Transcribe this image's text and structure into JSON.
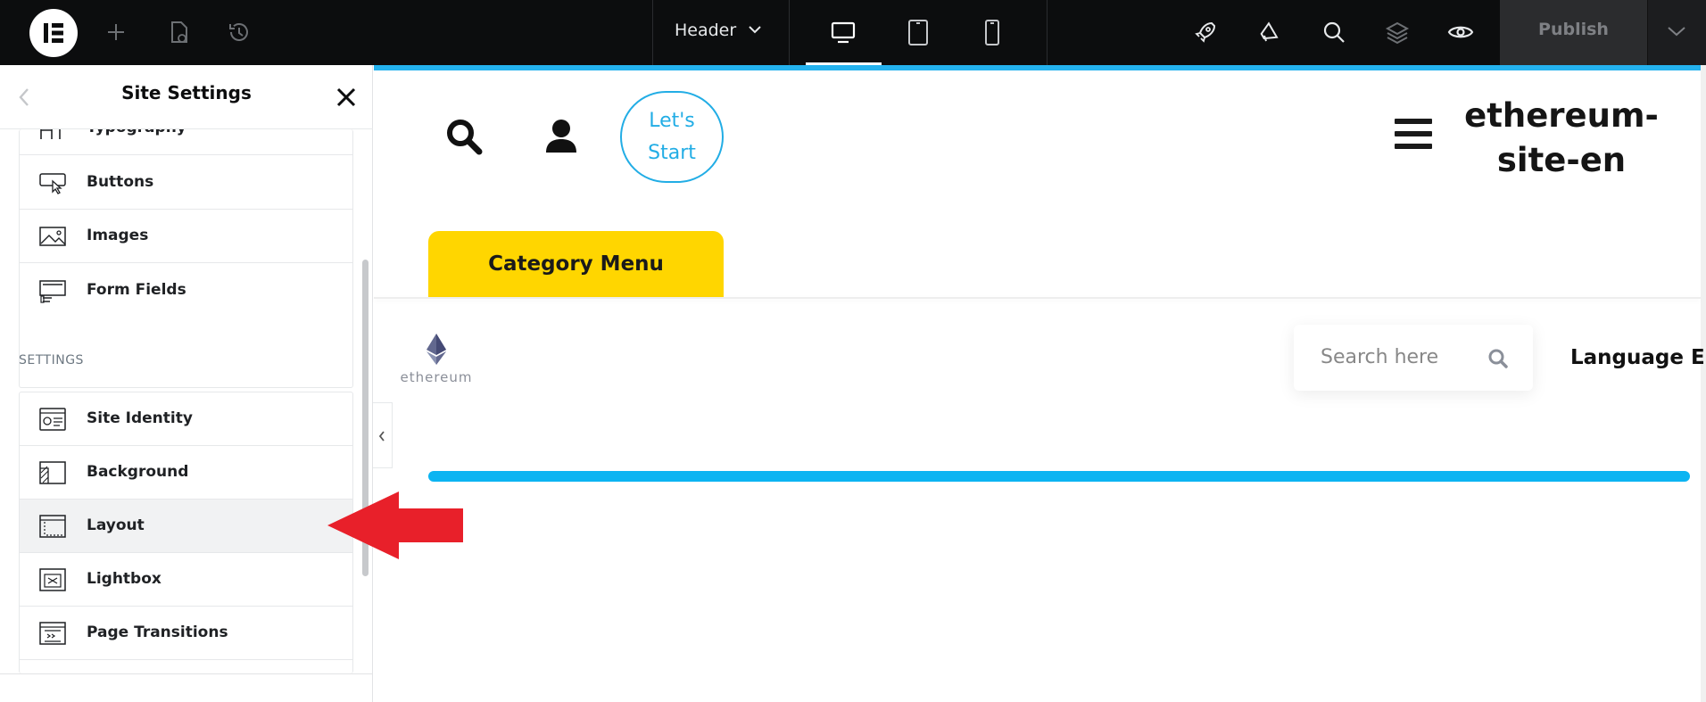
{
  "topbar": {
    "document_label": "Header",
    "publish_label": "Publish",
    "icons": [
      "elementor-logo-icon",
      "add-icon",
      "page-settings-icon",
      "history-icon",
      "desktop-icon",
      "tablet-icon",
      "mobile-icon",
      "rocket-icon",
      "megaphone-icon",
      "search-icon",
      "layers-icon",
      "eye-icon",
      "chevron-down-icon"
    ]
  },
  "panel": {
    "title": "Site Settings",
    "design_items": [
      {
        "label": "Typography",
        "icon": "typography-icon"
      },
      {
        "label": "Buttons",
        "icon": "button-cursor-icon"
      },
      {
        "label": "Images",
        "icon": "image-icon"
      },
      {
        "label": "Form Fields",
        "icon": "form-field-icon"
      }
    ],
    "settings_heading": "SETTINGS",
    "settings_items": [
      {
        "label": "Site Identity",
        "icon": "site-identity-icon"
      },
      {
        "label": "Background",
        "icon": "background-icon"
      },
      {
        "label": "Layout",
        "icon": "layout-icon",
        "active": true
      },
      {
        "label": "Lightbox",
        "icon": "lightbox-icon"
      },
      {
        "label": "Page Transitions",
        "icon": "page-transitions-icon"
      }
    ]
  },
  "canvas": {
    "cta_label": "Let's Start",
    "site_title": "ethereum-site-en",
    "category_menu_label": "Category Menu",
    "eth_logo_text": "ethereum",
    "search_placeholder": "Search here",
    "language_label": "Language EN"
  },
  "colors": {
    "topbar_bg": "#0c0d0e",
    "accent_blue": "#24b2ee",
    "category_yellow": "#ffd600",
    "annotation_red": "#e8202a"
  }
}
